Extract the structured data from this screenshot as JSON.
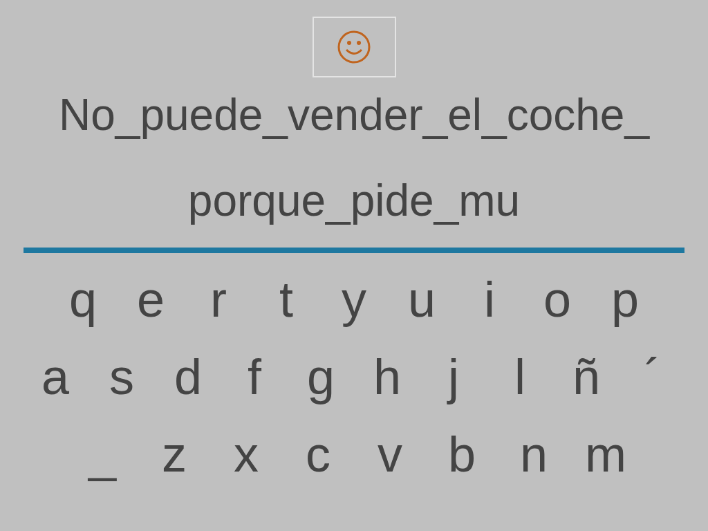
{
  "sentence_lines": [
    "No_puede_vender_el_coche_",
    "porque_pide_mu"
  ],
  "keyboard_rows": [
    [
      "q",
      "e",
      "r",
      "t",
      "y",
      "u",
      "i",
      "o",
      "p"
    ],
    [
      "a",
      "s",
      "d",
      "f",
      "g",
      "h",
      "j",
      "l",
      "ñ",
      "´"
    ],
    [
      "_",
      "z",
      "x",
      "c",
      "v",
      "b",
      "n",
      "m"
    ]
  ]
}
